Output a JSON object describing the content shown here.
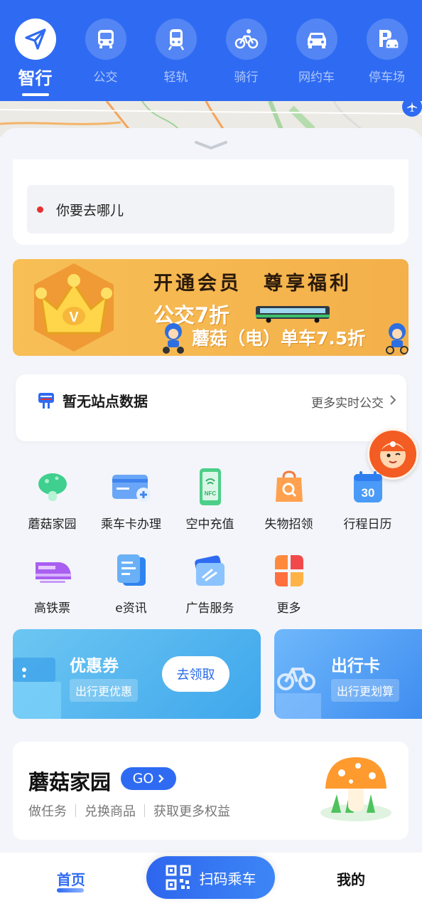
{
  "top_nav": {
    "items": [
      {
        "label": "智行",
        "icon": "send-icon",
        "active": true
      },
      {
        "label": "公交",
        "icon": "bus-icon"
      },
      {
        "label": "轻轨",
        "icon": "train-icon"
      },
      {
        "label": "骑行",
        "icon": "bicycle-icon"
      },
      {
        "label": "网约车",
        "icon": "car-icon"
      },
      {
        "label": "停车场",
        "icon": "parking-icon"
      }
    ]
  },
  "search": {
    "placeholder": "你要去哪儿"
  },
  "banner": {
    "title": "开通会员　尊享福利",
    "line1": "公交7折",
    "line2": "蘑菇（电）单车7.5折",
    "crown_letter": "V"
  },
  "station": {
    "title": "暂无站点数据",
    "more_label": "更多实时公交"
  },
  "grid": {
    "row1": [
      {
        "label": "蘑菇家园",
        "icon": "mushroom-icon"
      },
      {
        "label": "乘车卡办理",
        "icon": "card-icon"
      },
      {
        "label": "空中充值",
        "icon": "nfc-phone-icon"
      },
      {
        "label": "失物招领",
        "icon": "lost-bag-icon"
      },
      {
        "label": "行程日历",
        "icon": "calendar-icon",
        "badge": "30"
      }
    ],
    "row2": [
      {
        "label": "高铁票",
        "icon": "highspeed-train-icon"
      },
      {
        "label": "e资讯",
        "icon": "news-icon"
      },
      {
        "label": "广告服务",
        "icon": "ad-icon"
      },
      {
        "label": "更多",
        "icon": "more-icon"
      }
    ]
  },
  "promos": {
    "coupon": {
      "title": "优惠券",
      "subtitle": "出行更优惠",
      "button": "去领取"
    },
    "travel_card": {
      "title": "出行卡",
      "subtitle": "出行更划算"
    }
  },
  "home_card": {
    "title": "蘑菇家园",
    "badge": "GO",
    "tags": [
      "做任务",
      "兑换商品",
      "获取更多权益"
    ]
  },
  "bottom_bar": {
    "home": "首页",
    "scan": "扫码乘车",
    "mine": "我的"
  },
  "colors": {
    "primary": "#2f6bf2",
    "banner": "#f4b04a",
    "search_dot": "#e8302e"
  }
}
